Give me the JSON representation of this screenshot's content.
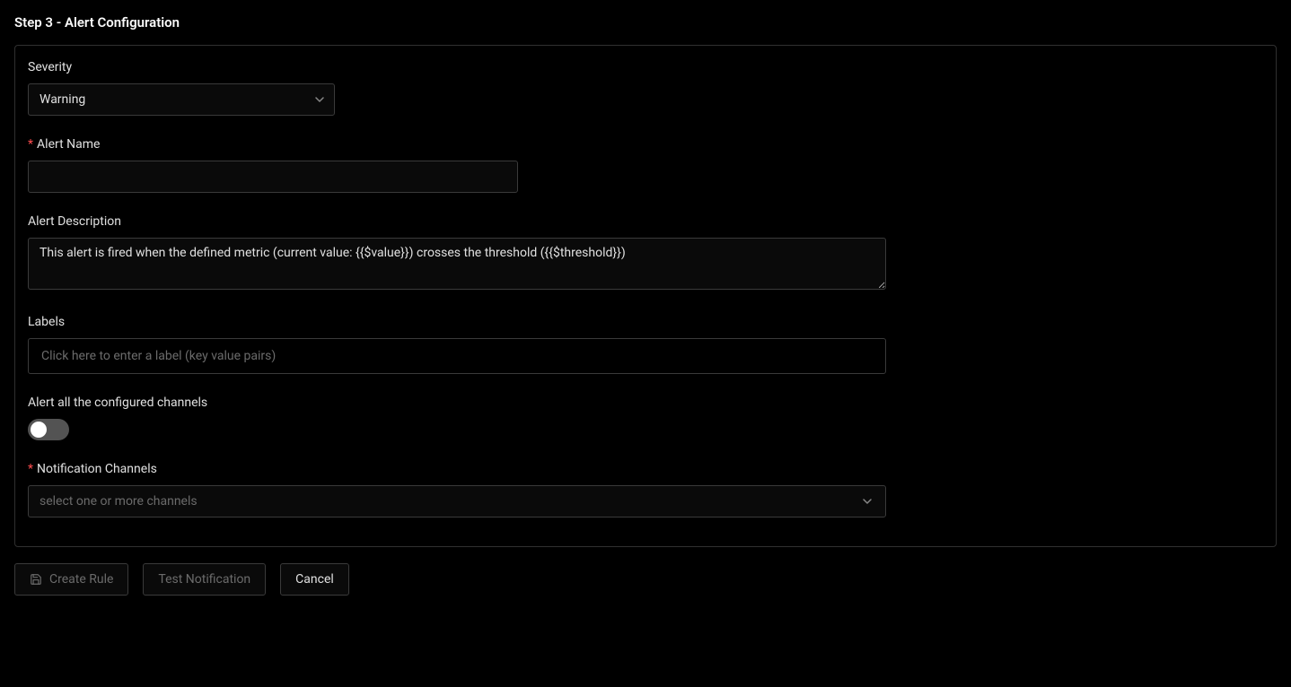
{
  "title": "Step 3 - Alert Configuration",
  "severity": {
    "label": "Severity",
    "value": "Warning"
  },
  "alert_name": {
    "label": "Alert Name",
    "value": ""
  },
  "alert_description": {
    "label": "Alert Description",
    "value": "This alert is fired when the defined metric (current value: {{$value}}) crosses the threshold ({{$threshold}})"
  },
  "labels": {
    "label": "Labels",
    "placeholder": "Click here to enter a label (key value pairs)"
  },
  "alert_all": {
    "label": "Alert all the configured channels",
    "enabled": false
  },
  "notification_channels": {
    "label": "Notification Channels",
    "placeholder": "select one or more channels"
  },
  "buttons": {
    "create": "Create Rule",
    "test": "Test Notification",
    "cancel": "Cancel"
  }
}
